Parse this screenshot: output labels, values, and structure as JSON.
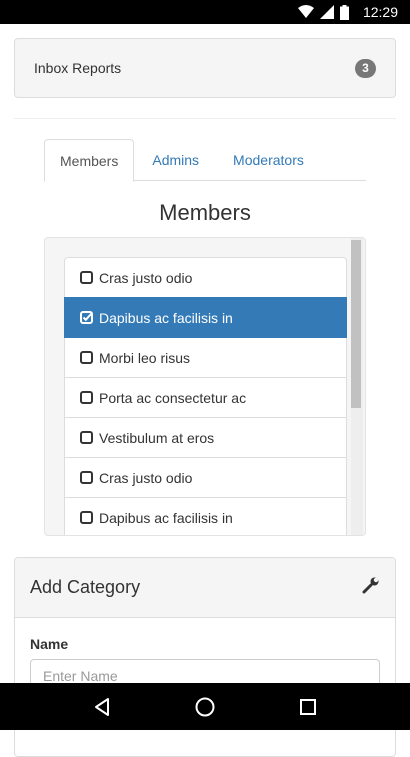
{
  "status_bar": {
    "time": "12:29",
    "icons": [
      "wifi-icon",
      "signal-icon",
      "battery-icon"
    ]
  },
  "inbox": {
    "title": "Inbox Reports",
    "count": "3"
  },
  "tabs": [
    {
      "label": "Members",
      "active": true
    },
    {
      "label": "Admins",
      "active": false
    },
    {
      "label": "Moderators",
      "active": false
    }
  ],
  "section_title": "Members",
  "members": [
    {
      "label": "Cras justo odio",
      "checked": false
    },
    {
      "label": "Dapibus ac facilisis in",
      "checked": true
    },
    {
      "label": "Morbi leo risus",
      "checked": false
    },
    {
      "label": "Porta ac consectetur ac",
      "checked": false
    },
    {
      "label": "Vestibulum at eros",
      "checked": false
    },
    {
      "label": "Cras justo odio",
      "checked": false
    },
    {
      "label": "Dapibus ac facilisis in",
      "checked": false
    }
  ],
  "add_category": {
    "title": "Add Category",
    "icon": "wrench-icon",
    "name_label": "Name",
    "name_placeholder": "Enter Name",
    "name_value": ""
  },
  "nav": {
    "buttons": [
      "back-icon",
      "home-icon",
      "recents-icon"
    ]
  },
  "colors": {
    "accent": "#337ab7",
    "badge": "#777777",
    "panel_bg": "#f5f5f5"
  }
}
